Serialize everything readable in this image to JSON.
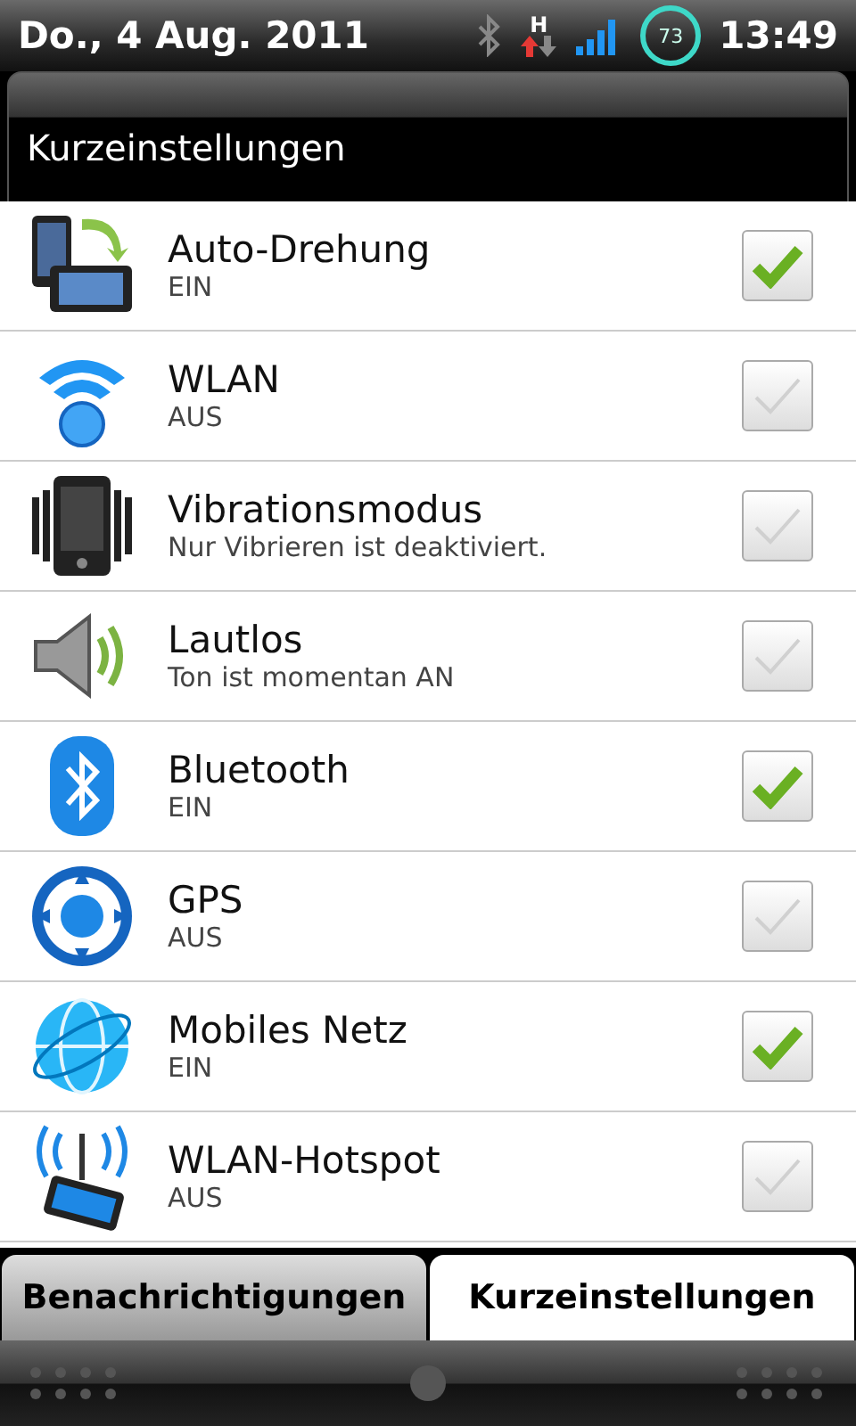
{
  "status_bar": {
    "date": "Do., 4 Aug. 2011",
    "network_type": "H",
    "battery": "73",
    "time": "13:49"
  },
  "header": {
    "title": "Kurzeinstellungen"
  },
  "settings": [
    {
      "title": "Auto-Drehung",
      "subtitle": "EIN",
      "checked": true
    },
    {
      "title": "WLAN",
      "subtitle": "AUS",
      "checked": false
    },
    {
      "title": "Vibrationsmodus",
      "subtitle": "Nur Vibrieren ist deaktiviert.",
      "checked": false
    },
    {
      "title": "Lautlos",
      "subtitle": "Ton ist momentan AN",
      "checked": false
    },
    {
      "title": "Bluetooth",
      "subtitle": "EIN",
      "checked": true
    },
    {
      "title": "GPS",
      "subtitle": "AUS",
      "checked": false
    },
    {
      "title": "Mobiles Netz",
      "subtitle": "EIN",
      "checked": true
    },
    {
      "title": "WLAN-Hotspot",
      "subtitle": "AUS",
      "checked": false
    }
  ],
  "tabs": [
    {
      "label": "Benachrichtigungen",
      "selected": false
    },
    {
      "label": "Kurzeinstellungen",
      "selected": true
    }
  ]
}
